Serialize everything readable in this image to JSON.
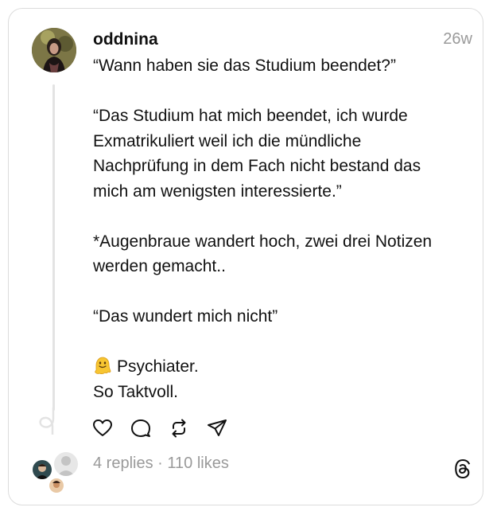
{
  "post": {
    "username": "oddnina",
    "timestamp": "26w",
    "lines": [
      "“Wann haben sie das Studium beendet?”",
      "",
      "“Das Studium hat mich beendet, ich wurde",
      "Exmatrikuliert weil ich die mündliche",
      "Nachprüfung in dem Fach nicht bestand das",
      "mich am wenigsten interessierte.”",
      "",
      "*Augenbraue wandert hoch, zwei drei Notizen",
      "werden gemacht..",
      "",
      "“Das wundert mich nicht”",
      ""
    ],
    "emoji_line": "Psychiater.",
    "last_line": "So Taktvoll."
  },
  "actions": {
    "icons": [
      "heart-icon",
      "comment-icon",
      "repost-icon",
      "send-icon"
    ]
  },
  "stats": {
    "replies": "4 replies",
    "separator": " · ",
    "likes": "110 likes"
  },
  "icons": {
    "brand": "threads-logo-icon",
    "emoji": "melting-face-emoji"
  },
  "colors": {
    "text": "#111111",
    "muted": "#9a9a9a",
    "border": "#dcdcdc",
    "thread_line": "#e3e3e3"
  }
}
